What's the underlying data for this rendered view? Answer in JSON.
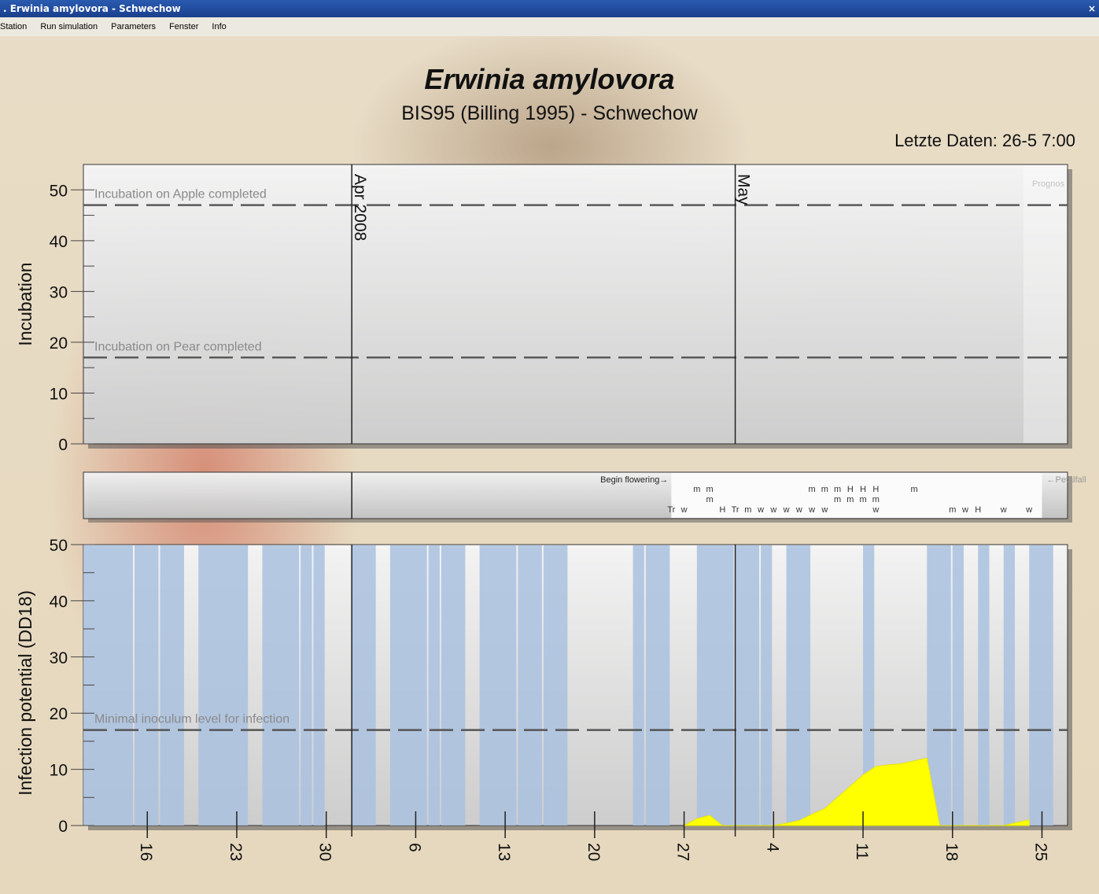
{
  "window": {
    "title": ". Erwinia amylovora - Schwechow",
    "close": "×"
  },
  "menu": [
    "Station",
    "Run simulation",
    "Parameters",
    "Fenster",
    "Info"
  ],
  "header": {
    "title": "Erwinia amylovora",
    "subtitle": "BIS95 (Billing 1995) - Schwechow",
    "last_data": "Letzte Daten: 26-5 7:00"
  },
  "chart_data": [
    {
      "type": "line",
      "ylabel": "Incubation",
      "ylim": [
        0,
        55
      ],
      "yticks": [
        0,
        10,
        20,
        30,
        40,
        50
      ],
      "x_range_days": [
        "11-3-2008",
        "27-5-2008"
      ],
      "month_markers": [
        {
          "label": "Apr 2008",
          "date": "2008-04-01"
        },
        {
          "label": "May",
          "date": "2008-05-01"
        }
      ],
      "reference_lines": [
        {
          "label": "Incubation on Apple completed",
          "y": 47
        },
        {
          "label": "Incubation on Pear completed",
          "y": 17
        }
      ],
      "prognosis_label": "Prognos"
    },
    {
      "type": "table",
      "event_labels": [
        {
          "text": "Begin flowering→",
          "date": "2008-04-26"
        },
        {
          "text": "←Petalfall",
          "date": "2008-05-25"
        }
      ],
      "event_rows": [
        {
          "row": 1,
          "items": [
            {
              "d": "2008-04-28",
              "t": "m"
            },
            {
              "d": "2008-04-29",
              "t": "m"
            },
            {
              "d": "2008-05-07",
              "t": "m"
            },
            {
              "d": "2008-05-08",
              "t": "m"
            },
            {
              "d": "2008-05-09",
              "t": "m"
            },
            {
              "d": "2008-05-10",
              "t": "H"
            },
            {
              "d": "2008-05-11",
              "t": "H"
            },
            {
              "d": "2008-05-12",
              "t": "H"
            },
            {
              "d": "2008-05-15",
              "t": "m"
            }
          ]
        },
        {
          "row": 2,
          "items": [
            {
              "d": "2008-04-29",
              "t": "m"
            },
            {
              "d": "2008-05-09",
              "t": "m"
            },
            {
              "d": "2008-05-10",
              "t": "m"
            },
            {
              "d": "2008-05-11",
              "t": "m"
            },
            {
              "d": "2008-05-12",
              "t": "m"
            }
          ]
        },
        {
          "row": 3,
          "items": [
            {
              "d": "2008-04-26",
              "t": "Tr"
            },
            {
              "d": "2008-04-27",
              "t": "w"
            },
            {
              "d": "2008-04-30",
              "t": "H"
            },
            {
              "d": "2008-05-01",
              "t": "Tr"
            },
            {
              "d": "2008-05-02",
              "t": "m"
            },
            {
              "d": "2008-05-03",
              "t": "w"
            },
            {
              "d": "2008-05-04",
              "t": "w"
            },
            {
              "d": "2008-05-05",
              "t": "w"
            },
            {
              "d": "2008-05-06",
              "t": "w"
            },
            {
              "d": "2008-05-07",
              "t": "w"
            },
            {
              "d": "2008-05-08",
              "t": "w"
            },
            {
              "d": "2008-05-12",
              "t": "w"
            },
            {
              "d": "2008-05-18",
              "t": "m"
            },
            {
              "d": "2008-05-19",
              "t": "w"
            },
            {
              "d": "2008-05-20",
              "t": "H"
            },
            {
              "d": "2008-05-22",
              "t": "w"
            },
            {
              "d": "2008-05-24",
              "t": "w"
            }
          ]
        }
      ]
    },
    {
      "type": "area",
      "ylabel": "Infection potential (DD18)",
      "ylim": [
        0,
        50
      ],
      "yticks": [
        0,
        10,
        20,
        30,
        40,
        50
      ],
      "x_ticks": [
        {
          "label": "16",
          "date": "2008-03-16"
        },
        {
          "label": "23",
          "date": "2008-03-23"
        },
        {
          "label": "30",
          "date": "2008-03-30"
        },
        {
          "label": "6",
          "date": "2008-04-06"
        },
        {
          "label": "13",
          "date": "2008-04-13"
        },
        {
          "label": "20",
          "date": "2008-04-20"
        },
        {
          "label": "27",
          "date": "2008-04-27"
        },
        {
          "label": "4",
          "date": "2008-05-04"
        },
        {
          "label": "11",
          "date": "2008-05-11"
        },
        {
          "label": "18",
          "date": "2008-05-18"
        },
        {
          "label": "25",
          "date": "2008-05-25"
        }
      ],
      "reference_lines": [
        {
          "label": "Minimal inoculum level for infection",
          "y": 17
        }
      ],
      "rain_periods": [
        [
          "2008-03-11",
          "2008-03-15"
        ],
        [
          "2008-03-15",
          "2008-03-17"
        ],
        [
          "2008-03-17",
          "2008-03-19"
        ],
        [
          "2008-03-20",
          "2008-03-24"
        ],
        [
          "2008-03-25",
          "2008-03-28"
        ],
        [
          "2008-03-28",
          "2008-03-29"
        ],
        [
          "2008-03-29",
          "2008-03-30"
        ],
        [
          "2008-04-01",
          "2008-04-03"
        ],
        [
          "2008-04-04",
          "2008-04-07"
        ],
        [
          "2008-04-07",
          "2008-04-08"
        ],
        [
          "2008-04-08",
          "2008-04-10"
        ],
        [
          "2008-04-11",
          "2008-04-14"
        ],
        [
          "2008-04-14",
          "2008-04-16"
        ],
        [
          "2008-04-16",
          "2008-04-18"
        ],
        [
          "2008-04-23",
          "2008-04-24"
        ],
        [
          "2008-04-24",
          "2008-04-26"
        ],
        [
          "2008-04-28",
          "2008-05-01"
        ],
        [
          "2008-05-01",
          "2008-05-03"
        ],
        [
          "2008-05-03",
          "2008-05-04"
        ],
        [
          "2008-05-05",
          "2008-05-07"
        ],
        [
          "2008-05-11",
          "2008-05-12"
        ],
        [
          "2008-05-16",
          "2008-05-18"
        ],
        [
          "2008-05-18",
          "2008-05-19"
        ],
        [
          "2008-05-20",
          "2008-05-21"
        ],
        [
          "2008-05-22",
          "2008-05-23"
        ],
        [
          "2008-05-24",
          "2008-05-26"
        ]
      ],
      "series": [
        {
          "x": [
            "2008-04-27",
            "2008-04-28",
            "2008-04-29",
            "2008-04-30",
            "2008-05-04",
            "2008-05-05",
            "2008-05-06",
            "2008-05-07",
            "2008-05-08",
            "2008-05-09",
            "2008-05-10",
            "2008-05-11",
            "2008-05-12",
            "2008-05-13",
            "2008-05-14",
            "2008-05-15",
            "2008-05-16",
            "2008-05-17",
            "2008-05-22",
            "2008-05-23",
            "2008-05-24"
          ],
          "values": [
            0,
            1.2,
            1.8,
            0,
            0,
            0.4,
            0.9,
            2.0,
            3.0,
            5.0,
            7.0,
            9.0,
            10.5,
            10.8,
            11.0,
            11.5,
            12.0,
            0,
            0,
            0.5,
            1.0
          ]
        }
      ],
      "colors": {
        "rain": "#a9c1df",
        "infection": "#ffff00",
        "reference": "#555555"
      }
    }
  ]
}
